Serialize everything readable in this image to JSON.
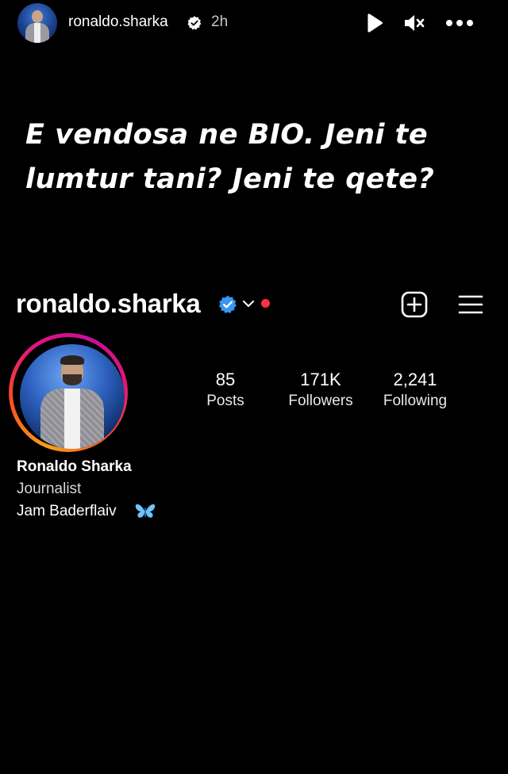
{
  "story_header": {
    "username": "ronaldo.sharka",
    "time": "2h",
    "icons": [
      "avatar",
      "verified-badge-icon",
      "play-icon",
      "mute-icon",
      "more-icon"
    ]
  },
  "caption": {
    "line1": "E vendosa ne BIO. Jeni te",
    "line2": "lumtur tani? Jeni te qete?"
  },
  "profile": {
    "username": "ronaldo.sharka",
    "icons": [
      "verified-badge-icon",
      "chevron-down-icon",
      "notification-dot",
      "add-post-icon",
      "menu-icon"
    ],
    "stats": {
      "posts": {
        "value": "85",
        "label": "Posts"
      },
      "followers": {
        "value": "171K",
        "label": "Followers"
      },
      "following": {
        "value": "2,241",
        "label": "Following"
      }
    },
    "bio": {
      "name": "Ronaldo Sharka",
      "category": "Journalist",
      "text": "Jam Baderflaiv",
      "emoji": "butterfly-icon"
    }
  },
  "colors": {
    "background": "#000000",
    "verified_blue": "#3897f0",
    "notification_red": "#ff3040",
    "story_ring": [
      "#f9a01b",
      "#f5501e",
      "#e3157b",
      "#c80f9a"
    ]
  }
}
